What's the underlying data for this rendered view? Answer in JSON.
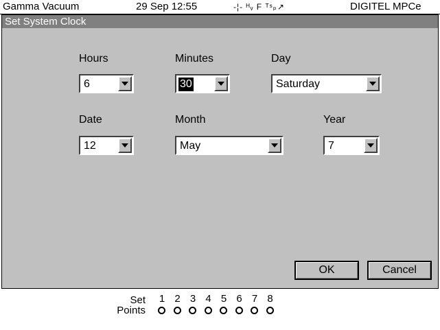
{
  "header": {
    "app_name": "Gamma Vacuum",
    "datetime": "29 Sep  12:55",
    "status_glyphs": "-¦- ᴴᵥ F ᵀˢₚ↗",
    "device": "DIGITEL MPCe"
  },
  "dialog": {
    "title": "Set System Clock",
    "fields": {
      "hours": {
        "label": "Hours",
        "value": "6"
      },
      "minutes": {
        "label": "Minutes",
        "value": "30"
      },
      "day": {
        "label": "Day",
        "value": "Saturday"
      },
      "date": {
        "label": "Date",
        "value": "12"
      },
      "month": {
        "label": "Month",
        "value": "May"
      },
      "year": {
        "label": "Year",
        "value": "7"
      }
    },
    "ok_label": "OK",
    "cancel_label": "Cancel"
  },
  "setpoints": {
    "label_line1": "Set",
    "label_line2": "Points",
    "numbers": [
      "1",
      "2",
      "3",
      "4",
      "5",
      "6",
      "7",
      "8"
    ]
  },
  "colors": {
    "dialog_bg": "#c0c0c0",
    "title_bg": "#808080",
    "selected_bg": "#000000"
  }
}
